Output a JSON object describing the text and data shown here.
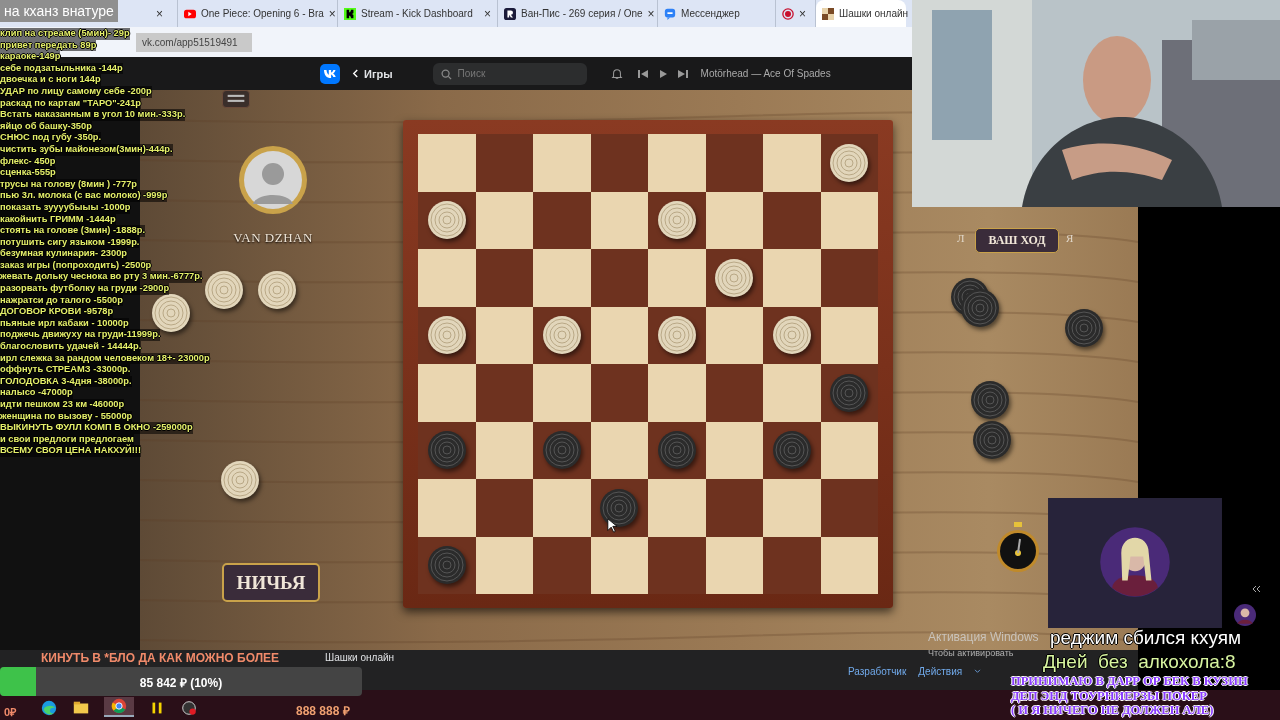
{
  "stream_title": "на кханз внатуре",
  "tabs": [
    {
      "selected": false,
      "close": "×"
    },
    {
      "title": "One Piece: Opening 6 - Bra",
      "selected": false,
      "close": "×"
    },
    {
      "title": "Stream - Kick Dashboard",
      "selected": false,
      "close": "×"
    },
    {
      "title": "Ван-Пис - 269 серия / One",
      "selected": false,
      "close": "×"
    },
    {
      "title": "Мессенджер",
      "selected": false
    },
    {
      "selected": false,
      "close": "×"
    },
    {
      "title": "Шашки онлайн",
      "selected": true
    }
  ],
  "address": "vk.com/app51519491",
  "vk_header": {
    "back": "Игры",
    "search": {
      "placeholder": "Поиск"
    },
    "track": "Motörhead — Ace Of Spades"
  },
  "price_list": [
    "клип на стреаме (5мин)- 29р",
    "привет передать 89р",
    "караоке-149р",
    "себе подзатыльника -144р",
    "двоечка и с ноги 144р",
    "УДАР по лицу самому себе -200р",
    "раскад по картам \"ТАРО\"-241р",
    "Встать наказанным в угол 10 мин.-333р.",
    "яйцо об башку-350р",
    "СНЮС под губу -350р.",
    "чистить зубы майонезом(3мин)-444р.",
    "флекс- 450р",
    "сценка-555р",
    "трусы на голову (8мин ) -777р",
    "пью 3л. молока (с вас молоко) -999р",
    "показать зуууубыыы -1000р",
    "какойнить ГРИММ -1444р",
    "стоять на голове (3мин) -1888р.",
    "потушить сигу языком -1999р.",
    "безумная кулинария- 2300р",
    "заказ игры (попроходить) -2500р",
    "жевать дольку чеснока во рту 3 мин.-6777р.",
    "разорвать футболку на груди -2900р",
    "нажратси до талого -5500р",
    "ДОГОВОР КРОВИ -9578р",
    "пьяные ирл кабаки - 10000р",
    "поджечь движуху на груди-11999р.",
    "благословить удачей - 14444р.",
    "ирл слежка за рандом человеком 18+- 23000р",
    "оффнуть СТРЕАМЗ -33000р.",
    "ГОЛОДОВКА 3-4дня -38000р.",
    "налысо -47000р",
    "идти пешком 23 км -46000р",
    "женщина по вызову - 55000р",
    "ВЫКИНУТЬ ФУЛЛ КОМП В ОКНО -259000р",
    "и свои предлоги предлогаем",
    "ВСЕМУ СВОЯ ЦЕНА НАКХУЙ!!!"
  ],
  "opponent": {
    "name": "VAN DZHAN"
  },
  "left_captured": [
    {
      "kind": "white"
    },
    {
      "kind": "white"
    },
    {
      "kind": "white"
    },
    {
      "kind": "white"
    }
  ],
  "board": {
    "rows": [
      [
        {
          "kind": "empty"
        },
        {
          "kind": "empty"
        },
        {
          "kind": "empty"
        },
        {
          "kind": "empty"
        },
        {
          "kind": "empty"
        },
        {
          "kind": "empty"
        },
        {
          "kind": "empty"
        },
        {
          "kind": "white"
        }
      ],
      [
        {
          "kind": "white"
        },
        {
          "kind": "empty"
        },
        {
          "kind": "empty"
        },
        {
          "kind": "empty"
        },
        {
          "kind": "white"
        },
        {
          "kind": "empty"
        },
        {
          "kind": "empty"
        },
        {
          "kind": "empty"
        }
      ],
      [
        {
          "kind": "empty"
        },
        {
          "kind": "empty"
        },
        {
          "kind": "empty"
        },
        {
          "kind": "empty"
        },
        {
          "kind": "empty"
        },
        {
          "kind": "white"
        },
        {
          "kind": "empty"
        },
        {
          "kind": "empty"
        }
      ],
      [
        {
          "kind": "white"
        },
        {
          "kind": "empty"
        },
        {
          "kind": "white"
        },
        {
          "kind": "empty"
        },
        {
          "kind": "white"
        },
        {
          "kind": "empty"
        },
        {
          "kind": "white"
        },
        {
          "kind": "empty"
        }
      ],
      [
        {
          "kind": "empty"
        },
        {
          "kind": "empty"
        },
        {
          "kind": "empty"
        },
        {
          "kind": "empty"
        },
        {
          "kind": "empty"
        },
        {
          "kind": "empty"
        },
        {
          "kind": "empty"
        },
        {
          "kind": "black"
        }
      ],
      [
        {
          "kind": "black"
        },
        {
          "kind": "empty"
        },
        {
          "kind": "black"
        },
        {
          "kind": "empty"
        },
        {
          "kind": "black"
        },
        {
          "kind": "empty"
        },
        {
          "kind": "black"
        },
        {
          "kind": "empty"
        }
      ],
      [
        {
          "kind": "empty"
        },
        {
          "kind": "empty"
        },
        {
          "kind": "empty"
        },
        {
          "kind": "black"
        },
        {
          "kind": "empty"
        },
        {
          "kind": "empty"
        },
        {
          "kind": "empty"
        },
        {
          "kind": "empty"
        }
      ],
      [
        {
          "kind": "black"
        },
        {
          "kind": "empty"
        },
        {
          "kind": "empty"
        },
        {
          "kind": "empty"
        },
        {
          "kind": "empty"
        },
        {
          "kind": "empty"
        },
        {
          "kind": "empty"
        },
        {
          "kind": "empty"
        }
      ]
    ]
  },
  "draw_button": "НИЧЬЯ",
  "turn_badge": {
    "left_fragment": "Л",
    "label": "ВАШ ХОД",
    "right_fragment": "Я"
  },
  "right_captured": [
    {
      "kind": "black"
    },
    {
      "kind": "black"
    },
    {
      "kind": "black"
    },
    {
      "kind": "black"
    },
    {
      "kind": "black"
    }
  ],
  "vk_footer": {
    "app_name": "Шашки онлайн",
    "links": [
      "Разработчик",
      "Действия"
    ]
  },
  "donation_goal": {
    "title": "КИНУТЬ В *БЛО ДА КАК МОЖНО БОЛЕЕ",
    "amount": "85 842 ₽ (10%)",
    "level": 0.1
  },
  "taskbar_amounts": [
    "0₽",
    "888 888 ₽"
  ],
  "windows_activation": {
    "title": "Активация Windows",
    "text": "Чтобы активировать"
  },
  "overlay_texts": {
    "status": "реджим сбился кхуям",
    "counter": "Дней  без  алкохола:8",
    "notice": [
      "ПРИНИМАЮ В ДАРР ОР БЕК В КУЗИН",
      "ДЕП ЭНД ТОУРНИЕРЗЫ ПОКЕР",
      "( И Я НИЧЕГО НЕ ДОЛЖЕН АЛЕ)"
    ]
  }
}
